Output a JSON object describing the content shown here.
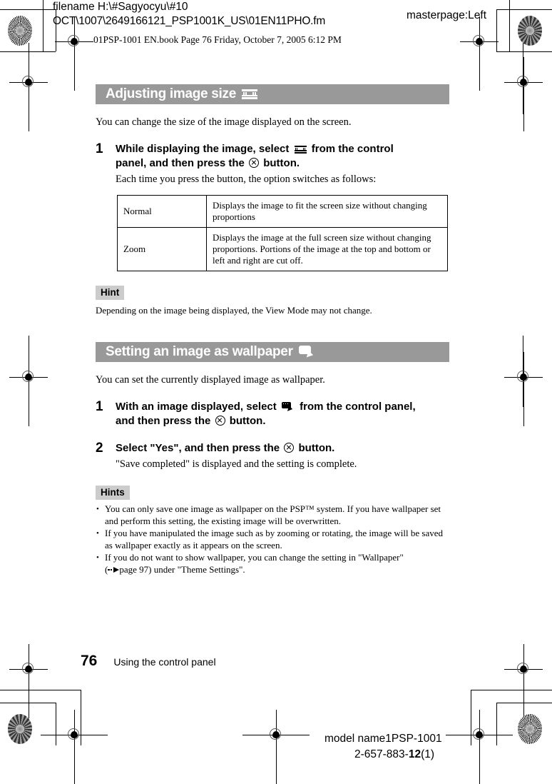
{
  "prepress": {
    "filename_label": "filename H:\\#Sagyocyu\\#10",
    "filename_path": "OCT\\1007\\2649166121_PSP1001K_US\\01EN11PHO.fm",
    "masterpage": "masterpage:Left",
    "bookline": "01PSP-1001 EN.book  Page 76  Friday, October 7, 2005  6:12 PM",
    "model_name": "model name1PSP-1001",
    "part_number_prefix": "2-657-883-",
    "part_number_bold": "12",
    "part_number_suffix": "(1)"
  },
  "sections": [
    {
      "title": "Adjusting image size",
      "icon": "screen-size-icon",
      "intro": "You can change the size of the image displayed on the screen.",
      "steps": [
        {
          "number": "1",
          "head_part1": "While displaying the image, select",
          "head_icon": "screen-size-icon",
          "head_part2": "from the control",
          "head_line2_part1": "panel, and then press the",
          "head_icon2": "cross-button-icon",
          "head_line2_part2": "button.",
          "sub": "Each time you press the button, the option switches as follows:"
        }
      ],
      "table": {
        "rows": [
          {
            "name": "Normal",
            "description": "Displays the image to fit the screen size without changing proportions"
          },
          {
            "name": "Zoom",
            "description": "Displays the image at the full screen size without changing proportions. Portions of the image at the top and bottom or left and right are cut off."
          }
        ]
      },
      "hint_tag": "Hint",
      "hint_text": "Depending on the image being displayed, the View Mode may not change."
    },
    {
      "title": "Setting an image as wallpaper",
      "icon": "wallpaper-icon",
      "intro": "You can set the currently displayed image as wallpaper.",
      "steps": [
        {
          "number": "1",
          "head_part1": "With an image displayed, select",
          "head_icon": "wallpaper-icon",
          "head_part2": "from the control panel,",
          "head_line2_part1": "and then press the",
          "head_icon2": "cross-button-icon",
          "head_line2_part2": "button.",
          "sub": ""
        },
        {
          "number": "2",
          "head_part1": "Select \"Yes\", and then press the",
          "head_icon2": "cross-button-icon",
          "head_line2_part2": "button.",
          "sub": "\"Save completed\" is displayed and the setting is complete."
        }
      ],
      "hint_tag": "Hints",
      "hints": [
        "You can only save one image as wallpaper on the PSP™ system. If you have wallpaper set and perform this setting, the existing image will be overwritten.",
        "If you have manipulated the image such as by zooming or rotating, the image will be saved as wallpaper exactly as it appears on the screen.",
        "If you do not want to show wallpaper, you can change the setting in \"Wallpaper\""
      ],
      "hint_xref_prefix": "(",
      "hint_xref_text": "page 97",
      "hint_xref_suffix": ") under \"Theme Settings\"."
    }
  ],
  "footer": {
    "page_number": "76",
    "running_head": "Using the control panel"
  },
  "colors": {
    "section_bar": "#999999",
    "hint_tag": "#cccccc",
    "text": "#000000",
    "page": "#ffffff"
  }
}
